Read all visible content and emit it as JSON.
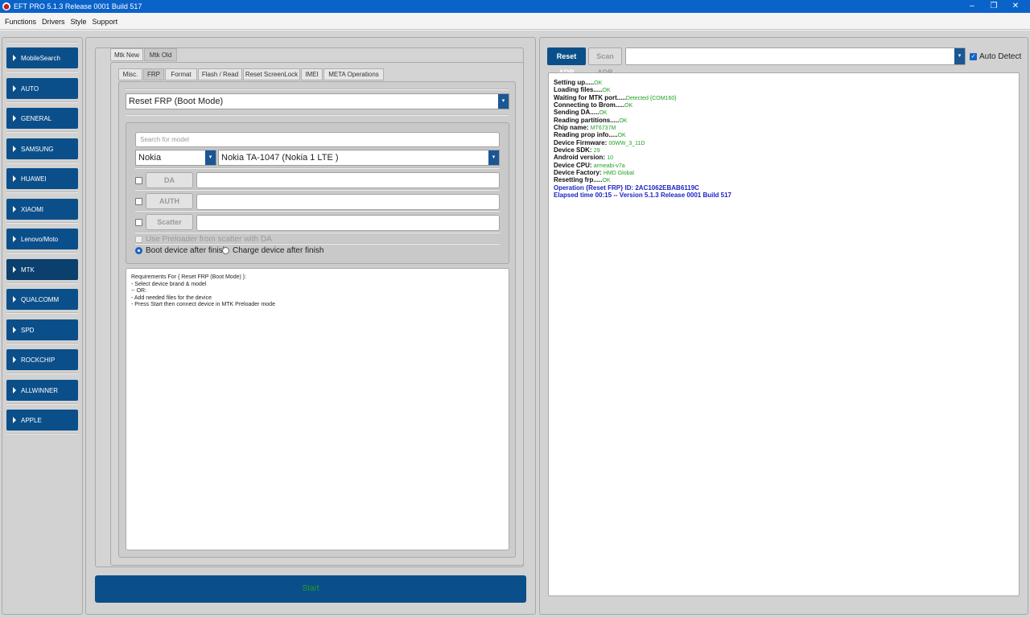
{
  "window": {
    "title": "EFT PRO 5.1.3 Release 0001 Build 517",
    "controls": [
      "–",
      "❐",
      "✕"
    ]
  },
  "menu": [
    "Functions",
    "Drivers",
    "Style",
    "Support"
  ],
  "sidebar": [
    "MobileSearch",
    "AUTO",
    "GENERAL",
    "SAMSUNG",
    "HUAWEI",
    "XIAOMI",
    "Lenovo/Moto",
    "MTK",
    "QUALCOMM",
    "SPD",
    "ROCKCHIP",
    "ALLWINNER",
    "APPLE"
  ],
  "top_tabs": [
    "Mtk New",
    "Mtk Old"
  ],
  "sub_tabs": [
    "Misc.",
    "FRP",
    "Format",
    "Flash / Read",
    "Reset ScreenLock",
    "IMEI",
    "META Operations"
  ],
  "operation_select": "Reset FRP (Boot Mode)",
  "search": {
    "placeholder": "Search for model"
  },
  "brand_select": "Nokia",
  "model_select": "Nokia TA-1047 (Nokia 1 LTE )",
  "file_buttons": [
    "DA",
    "AUTH",
    "Scatter"
  ],
  "use_preloader_label": "Use Preloader from scatter with DA",
  "radio_options": [
    "Boot device after finish",
    "Charge device after finish"
  ],
  "requirements": [
    "Requirements For { Reset FRP (Boot Mode) }:",
    " - Select device brand & model",
    " -- OR:",
    " - Add needed files for the device",
    " - Press Start then connect device in MTK Preloader mode"
  ],
  "start_label": "Start",
  "adb": {
    "reset_label": "Reset ADB",
    "scan_label": "Scan ADB",
    "dropdown_value": "",
    "auto_detect_label": "Auto Detect"
  },
  "log": [
    {
      "k": "Setting up.....",
      "v": "OK"
    },
    {
      "k": "Loading files.....",
      "v": "OK"
    },
    {
      "k": "Waiting for MTK port.....",
      "v": "Detected {COM160}"
    },
    {
      "k": "Connecting to Brom.....",
      "v": "OK"
    },
    {
      "k": "Sending DA.....",
      "v": "OK"
    },
    {
      "k": "Reading partitions.....",
      "v": "OK"
    },
    {
      "k": "Chip name: ",
      "v": "MT6737M"
    },
    {
      "k": "Reading prop info.....",
      "v": "OK"
    },
    {
      "k": "Device Firmware: ",
      "v": "00WW_3_11D"
    },
    {
      "k": "Device SDK: ",
      "v": "29"
    },
    {
      "k": "Android version: ",
      "v": "10"
    },
    {
      "k": "Device CPU: ",
      "v": "armeabi-v7a"
    },
    {
      "k": "Device Factory: ",
      "v": "HMD Global"
    },
    {
      "k": "Resetting frp.....",
      "v": "OK"
    }
  ],
  "log_blue": [
    "Operation {Reset FRP} ID: 2AC1062EBAB6119C",
    "Elapsed time 00:15 -- Version 5.1.3 Release 0001 Build 517"
  ],
  "colors": {
    "titlebar": "#0a63c9",
    "button_blue": "#0b4f8a",
    "ok_green": "#22a022",
    "log_blue": "#1c23c4"
  }
}
